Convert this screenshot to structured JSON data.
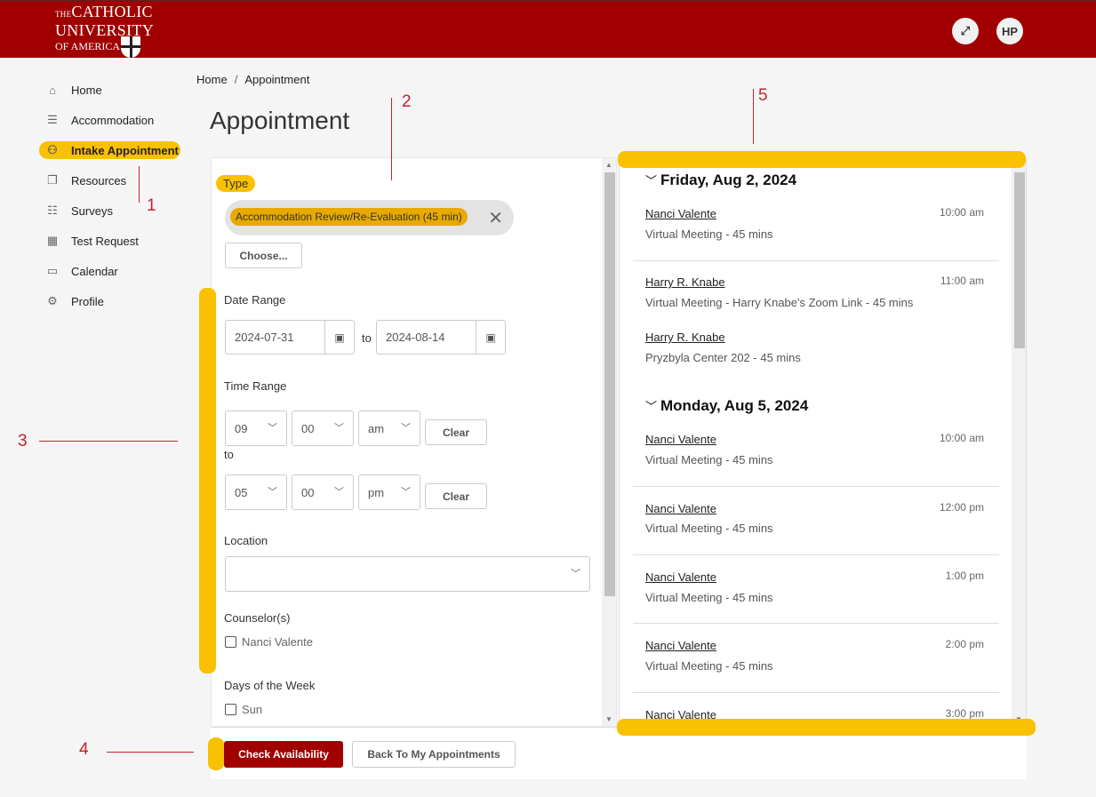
{
  "header": {
    "logo": {
      "the": "THE",
      "line1": "CATHOLIC",
      "line2": "UNIVERSITY",
      "line3": "OF AMERICA"
    },
    "expand_icon": "expand-icon",
    "avatar_initials": "HP"
  },
  "sidebar": {
    "items": [
      {
        "label": "Home",
        "icon": "⌂"
      },
      {
        "label": "Accommodation",
        "icon": "☰"
      },
      {
        "label": "Intake Appointment",
        "icon": "⚇",
        "active": true
      },
      {
        "label": "Resources",
        "icon": "❐"
      },
      {
        "label": "Surveys",
        "icon": "☷"
      },
      {
        "label": "Test Request",
        "icon": "▦"
      },
      {
        "label": "Calendar",
        "icon": "▭"
      },
      {
        "label": "Profile",
        "icon": "⚙"
      }
    ]
  },
  "breadcrumb": {
    "home": "Home",
    "separator": "/",
    "current": "Appointment"
  },
  "page_title": "Appointment",
  "form": {
    "type_label": "Type",
    "type_chip": "Accommodation Review/Re-Evaluation (45 min)",
    "chip_remove": "✕",
    "choose_button": "Choose...",
    "date_range_label": "Date Range",
    "date_from": "2024-07-31",
    "date_to": "2024-08-14",
    "date_to_sep": "to",
    "time_range_label": "Time Range",
    "start_hour": "09",
    "start_min": "00",
    "start_ampm": "am",
    "end_hour": "05",
    "end_min": "00",
    "end_ampm": "pm",
    "time_to_sep": "to",
    "clear_button": "Clear",
    "location_label": "Location",
    "location_value": "",
    "counselors_label": "Counselor(s)",
    "counselor_option": "Nanci Valente",
    "days_label": "Days of the Week",
    "day_option": "Sun"
  },
  "footer": {
    "check_button": "Check Availability",
    "back_button": "Back To My Appointments"
  },
  "slots": {
    "days": [
      {
        "date": "Friday, Aug 2, 2024",
        "slots": [
          {
            "counselor": "Nanci Valente",
            "detail": "Virtual Meeting - 45 mins",
            "time": "10:00 am"
          },
          {
            "counselor": "Harry R. Knabe",
            "detail": "Virtual Meeting - Harry Knabe's Zoom Link - 45 mins",
            "time": "11:00 am"
          },
          {
            "counselor": "Harry R. Knabe",
            "detail": "Pryzbyla Center 202 - 45 mins",
            "time": ""
          }
        ]
      },
      {
        "date": "Monday, Aug 5, 2024",
        "slots": [
          {
            "counselor": "Nanci Valente",
            "detail": "Virtual Meeting - 45 mins",
            "time": "10:00 am"
          },
          {
            "counselor": "Nanci Valente",
            "detail": "Virtual Meeting - 45 mins",
            "time": "12:00 pm"
          },
          {
            "counselor": "Nanci Valente",
            "detail": "Virtual Meeting - 45 mins",
            "time": "1:00 pm"
          },
          {
            "counselor": "Nanci Valente",
            "detail": "Virtual Meeting - 45 mins",
            "time": "2:00 pm"
          },
          {
            "counselor": "Nanci Valente",
            "detail": "",
            "time": "3:00 pm"
          }
        ]
      }
    ]
  },
  "annotations": {
    "a1": "1",
    "a2": "2",
    "a3": "3",
    "a4": "4",
    "a5": "5"
  },
  "colors": {
    "brand": "#a00000",
    "highlight": "#f9c100",
    "annotation": "#c0242f"
  }
}
